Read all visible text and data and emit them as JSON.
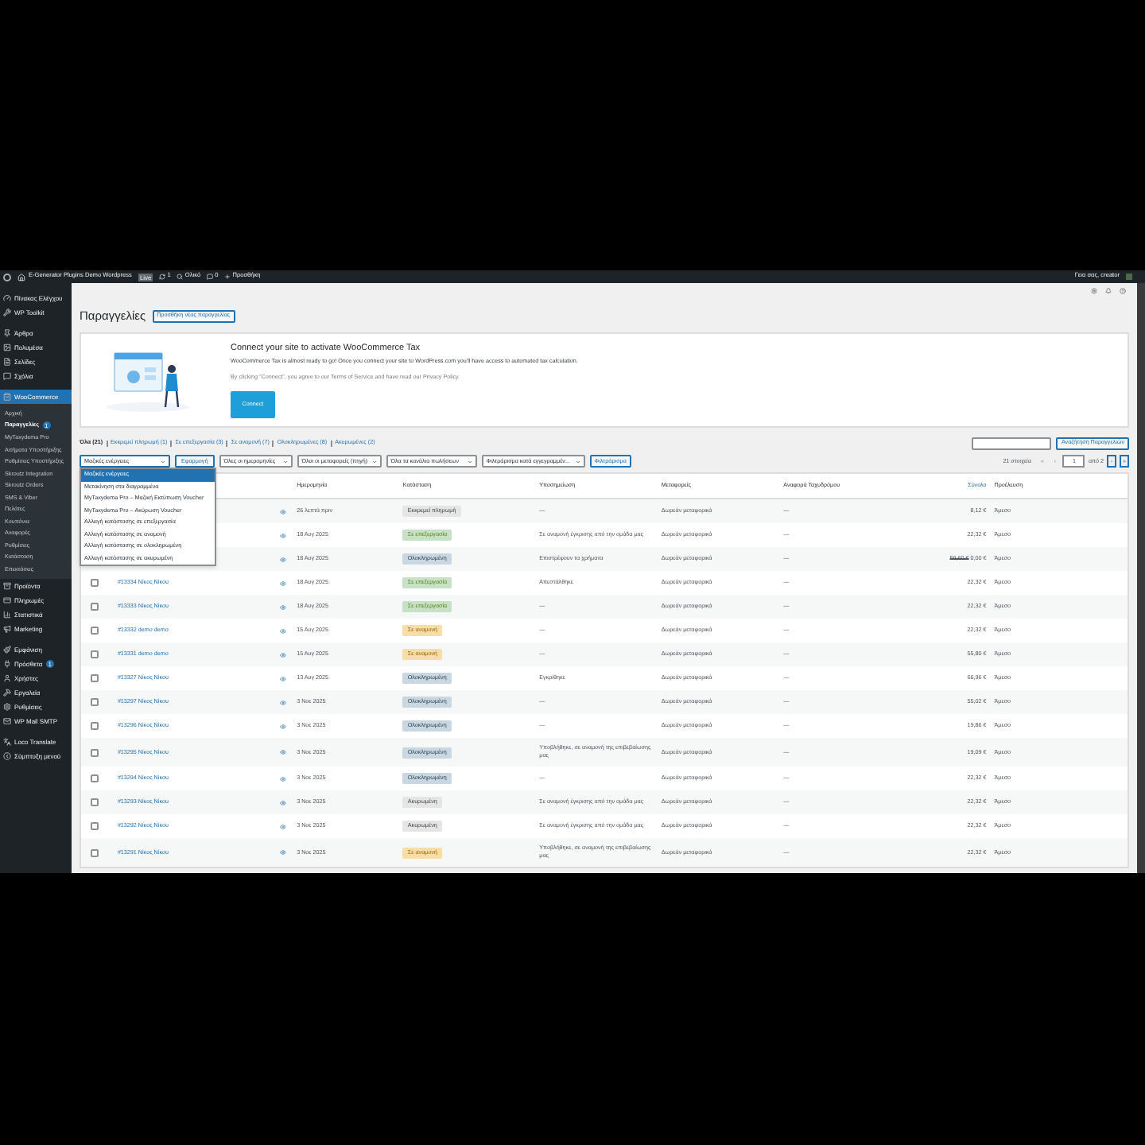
{
  "admin_bar": {
    "site": "Ε-Generator Plugins Demo Wordpress",
    "badge": "Live",
    "updates": "1",
    "search": "Ολικό",
    "comments": "0",
    "new": "Προσθήκη",
    "greeting": "Γεια σας, creator"
  },
  "sidebar": {
    "groups": [
      [
        {
          "label": "Πίνακας Ελέγχου",
          "selected": false
        },
        {
          "label": "WP Toolkit",
          "selected": false
        }
      ],
      [
        {
          "label": "Άρθρα",
          "selected": false
        },
        {
          "label": "Πολυμέσα",
          "selected": false
        },
        {
          "label": "Σελίδες",
          "selected": false
        },
        {
          "label": "Σχόλια",
          "selected": false
        }
      ],
      [
        {
          "label": "WooCommerce",
          "selected": true,
          "children": [
            {
              "label": "Αρχική",
              "selected": false
            },
            {
              "label": "Παραγγελίες",
              "selected": true,
              "badge": "1"
            },
            {
              "label": "MyTaxydema Pro",
              "selected": false
            },
            {
              "label": "Αιτήματα Υποστήριξης",
              "selected": false
            },
            {
              "label": "Ρυθμίσεις Υποστήριξης",
              "selected": false
            },
            {
              "label": "Skroutz Integration",
              "selected": false
            },
            {
              "label": "Skroutz Orders",
              "selected": false
            },
            {
              "label": "SMS & Viber",
              "selected": false
            },
            {
              "label": "Πελάτες",
              "selected": false
            },
            {
              "label": "Κουπόνια",
              "selected": false
            },
            {
              "label": "Αναφορές",
              "selected": false
            },
            {
              "label": "Ρυθμίσεις",
              "selected": false
            },
            {
              "label": "Κατάσταση",
              "selected": false
            },
            {
              "label": "Επεκτάσεις",
              "selected": false
            }
          ]
        },
        {
          "label": "Προϊόντα",
          "selected": false
        },
        {
          "label": "Πληρωμές",
          "selected": false
        },
        {
          "label": "Στατιστικά",
          "selected": false
        },
        {
          "label": "Marketing",
          "selected": false
        }
      ],
      [
        {
          "label": "Εμφάνιση",
          "selected": false
        },
        {
          "label": "Πρόσθετα",
          "selected": false,
          "badge": "1"
        },
        {
          "label": "Χρήστες",
          "selected": false
        },
        {
          "label": "Εργαλεία",
          "selected": false
        },
        {
          "label": "Ρυθμίσεις",
          "selected": false
        },
        {
          "label": "WP Mail SMTP",
          "selected": false
        }
      ],
      [
        {
          "label": "Loco Translate",
          "selected": false
        },
        {
          "label": "Σύμπτυξη μενού",
          "selected": false
        }
      ]
    ]
  },
  "page": {
    "title": "Παραγγελίες",
    "add_button": "Προσθήκη νέας παραγγελίας"
  },
  "banner": {
    "title": "Connect your site to activate WooCommerce Tax",
    "text": "WooCommerce Tax is almost ready to go! Once you connect your site to WordPress.com you'll have access to automated tax calculation.",
    "fine_print": "By clicking \"Connect\", you agree to our Terms of Service and have read our Privacy Policy.",
    "button": "Connect"
  },
  "status_links": [
    {
      "label": "Όλα (21)",
      "selected": true
    },
    {
      "label": "Εκκρεμεί πληρωμή (1)",
      "selected": false
    },
    {
      "label": "Σε επεξεργασία (3)",
      "selected": false
    },
    {
      "label": "Σε αναμονή (7)",
      "selected": false
    },
    {
      "label": "Ολοκληρωμένες (8)",
      "selected": false
    },
    {
      "label": "Ακυρωμένες (2)",
      "selected": false
    }
  ],
  "search": {
    "button": "Αναζήτηση Παραγγελιών"
  },
  "bulk": {
    "value": "Μαζικές ενέργειες",
    "apply": "Εφαρμογή",
    "expanded": true,
    "options": [
      {
        "label": "Μαζικές ενέργειες",
        "selected": true
      },
      {
        "label": "Μετακίνηση στα διαγραμμένα",
        "selected": false
      },
      {
        "label": "MyTaxydema Pro – Μαζική Εκτύπωση Voucher",
        "selected": false
      },
      {
        "label": "MyTaxydema Pro – Ακύρωση Voucher",
        "selected": false
      },
      {
        "label": "Αλλαγή κατάστασης σε επεξεργασία",
        "selected": false
      },
      {
        "label": "Αλλαγή κατάστασης σε αναμονή",
        "selected": false
      },
      {
        "label": "Αλλαγή κατάστασης σε ολοκληρωμένη",
        "selected": false
      },
      {
        "label": "Αλλαγή κατάστασης σε ακυρωμένη",
        "selected": false
      }
    ]
  },
  "filters": [
    "Όλες οι ημερομηνίες",
    "Όλοι οι μεταφορείς (πηγή)",
    "Όλα τα κανάλια πωλήσεων",
    "Φιλτράρισμα κατά εγγεγραμμέν..."
  ],
  "filter_button": "Φιλτράρισμα",
  "pagination": {
    "count": "21 στοιχεία",
    "first": "«",
    "prev": "‹",
    "page": "1",
    "of": "από 2",
    "next": "›",
    "last": "»"
  },
  "table": {
    "columns": [
      "Ημερομηνία",
      "Κατάσταση",
      "Υποσημείωση",
      "Μεταφορείς",
      "Αναφορά Ταχυδρόμου",
      "Σύνολο",
      "Προέλευση"
    ],
    "rows": [
      {
        "date": "26 λεπτά πριν",
        "status": {
          "label": "Εκκρεμεί πληρωμή",
          "kind": "pending"
        },
        "note": "—",
        "shipping": "Δωρεάν μεταφορικά",
        "ref": "—",
        "total": "8,12 €",
        "origin": "Άμεσο"
      },
      {
        "date": "18 Αυγ 2025",
        "status": {
          "label": "Σε επεξεργασία",
          "kind": "processing"
        },
        "note": "Σε αναμονή έγκρισης από την ομάδα μας",
        "shipping": "Δωρεάν μεταφορικά",
        "ref": "—",
        "total": "22,32 €",
        "origin": "Άμεσο"
      },
      {
        "date": "18 Αυγ 2025",
        "status": {
          "label": "Ολοκληρωμένη",
          "kind": "completed"
        },
        "note": "Επιστρέφουν τα χρήματα",
        "shipping": "Δωρεάν μεταφορικά",
        "ref": "—",
        "old_total": "59,60 €",
        "total": "0,00 €",
        "origin": "Άμεσο"
      },
      {
        "checked": false,
        "order": "#13334 Νίκος Νίκου",
        "date": "18 Αυγ 2025",
        "status": {
          "label": "Σε επεξεργασία",
          "kind": "processing"
        },
        "note": "Απεστάλθηκε",
        "shipping": "Δωρεάν μεταφορικά",
        "ref": "—",
        "total": "22,32 €",
        "origin": "Άμεσο"
      },
      {
        "checked": false,
        "order": "#13333 Νίκος Νίκου",
        "date": "18 Αυγ 2025",
        "status": {
          "label": "Σε επεξεργασία",
          "kind": "processing"
        },
        "note": "—",
        "shipping": "Δωρεάν μεταφορικά",
        "ref": "—",
        "total": "22,32 €",
        "origin": "Άμεσο"
      },
      {
        "checked": false,
        "order": "#13332 demo demo",
        "date": "15 Αυγ 2025",
        "status": {
          "label": "Σε αναμονή",
          "kind": "on-hold"
        },
        "note": "—",
        "shipping": "Δωρεάν μεταφορικά",
        "ref": "—",
        "total": "22,32 €",
        "origin": "Άμεσο"
      },
      {
        "checked": false,
        "order": "#13331 demo demo",
        "date": "15 Αυγ 2025",
        "status": {
          "label": "Σε αναμονή",
          "kind": "on-hold"
        },
        "note": "—",
        "shipping": "Δωρεάν μεταφορικά",
        "ref": "—",
        "total": "55,80 €",
        "origin": "Άμεσο"
      },
      {
        "checked": false,
        "order": "#13327 Νίκος Νίκου",
        "date": "13 Αυγ 2025",
        "status": {
          "label": "Ολοκληρωμένη",
          "kind": "completed"
        },
        "note": "Εγκρίθηκε",
        "shipping": "Δωρεάν μεταφορικά",
        "ref": "—",
        "total": "66,96 €",
        "origin": "Άμεσο"
      },
      {
        "checked": false,
        "order": "#13297 Νίκος Νίκου",
        "date": "3 Νοε 2025",
        "status": {
          "label": "Ολοκληρωμένη",
          "kind": "completed"
        },
        "note": "—",
        "shipping": "Δωρεάν μεταφορικά",
        "ref": "—",
        "total": "55,02 €",
        "origin": "Άμεσο"
      },
      {
        "checked": false,
        "order": "#13296 Νίκος Νίκου",
        "date": "3 Νοε 2025",
        "status": {
          "label": "Ολοκληρωμένη",
          "kind": "completed"
        },
        "note": "—",
        "shipping": "Δωρεάν μεταφορικά",
        "ref": "—",
        "total": "19,86 €",
        "origin": "Άμεσο"
      },
      {
        "checked": false,
        "order": "#13295 Νίκος Νίκου",
        "date": "3 Νοε 2025",
        "status": {
          "label": "Ολοκληρωμένη",
          "kind": "completed"
        },
        "note": "Υποβλήθηκε, σε αναμονή της επιβεβαίωσης μας",
        "shipping": "Δωρεάν μεταφορικά",
        "ref": "—",
        "total": "19,09 €",
        "origin": "Άμεσο"
      },
      {
        "checked": false,
        "order": "#13294 Νίκος Νίκου",
        "date": "3 Νοε 2025",
        "status": {
          "label": "Ολοκληρωμένη",
          "kind": "completed"
        },
        "note": "—",
        "shipping": "Δωρεάν μεταφορικά",
        "ref": "—",
        "total": "22,32 €",
        "origin": "Άμεσο"
      },
      {
        "checked": false,
        "order": "#13293 Νίκος Νίκου",
        "date": "3 Νοε 2025",
        "status": {
          "label": "Ακυρωμένη",
          "kind": "cancelled"
        },
        "note": "Σε αναμονή έγκρισης από την ομάδα μας",
        "shipping": "Δωρεάν μεταφορικά",
        "ref": "—",
        "total": "22,32 €",
        "origin": "Άμεσο"
      },
      {
        "checked": false,
        "order": "#13292 Νίκος Νίκου",
        "date": "3 Νοε 2025",
        "status": {
          "label": "Ακυρωμένη",
          "kind": "cancelled"
        },
        "note": "Σε αναμονή έγκρισης από την ομάδα μας",
        "shipping": "Δωρεάν μεταφορικά",
        "ref": "—",
        "total": "22,32 €",
        "origin": "Άμεσο"
      },
      {
        "checked": false,
        "order": "#13291 Νίκος Νίκου",
        "date": "3 Νοε 2025",
        "status": {
          "label": "Σε αναμονή",
          "kind": "on-hold"
        },
        "note": "Υποβλήθηκε, σε αναμονή της επιβεβαίωσης μας",
        "shipping": "Δωρεάν μεταφορικά",
        "ref": "—",
        "total": "22,32 €",
        "origin": "Άμεσο"
      }
    ]
  }
}
